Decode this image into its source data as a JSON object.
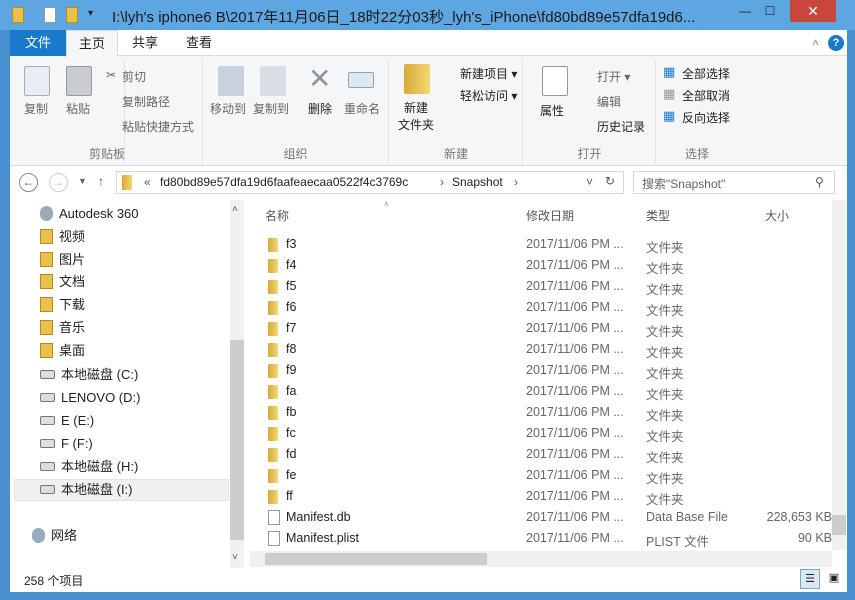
{
  "window": {
    "title": "I:\\lyh's iphone6 B\\2017年11月06日_18时22分03秒_lyh's_iPhone\\fd80bd89e57dfa19d6...",
    "close": "✕",
    "maximize": "☐",
    "minimize": "—"
  },
  "ribbon_tabs": [
    "文件",
    "主页",
    "共享",
    "查看"
  ],
  "ribbon": {
    "clipboard": {
      "label": "剪贴板",
      "copy": "复制",
      "paste": "粘贴",
      "cut": "剪切",
      "copy_path": "复制路径",
      "paste_shortcut": "粘贴快捷方式"
    },
    "organize": {
      "label": "组织",
      "move_to": "移动到",
      "copy_to": "复制到",
      "delete": "删除",
      "rename": "重命名"
    },
    "new": {
      "label": "新建",
      "new_folder": "新建\n文件夹",
      "new_item": "新建项目 ▾",
      "easy_access": "轻松访问 ▾"
    },
    "open": {
      "label": "打开",
      "properties": "属性",
      "open": "打开 ▾",
      "edit": "编辑",
      "history": "历史记录"
    },
    "select": {
      "label": "选择",
      "select_all": "全部选择",
      "select_none": "全部取消",
      "invert": "反向选择"
    }
  },
  "address": {
    "prefix": "«",
    "segment1": "fd80bd89e57dfa19d6faafeaecaa0522f4c3769c",
    "sep": "›",
    "segment2": "Snapshot",
    "search_placeholder": "搜索\"Snapshot\""
  },
  "nav": [
    "Autodesk 360",
    "视频",
    "图片",
    "文档",
    "下载",
    "音乐",
    "桌面",
    "本地磁盘 (C:)",
    "LENOVO (D:)",
    "E (E:)",
    "F (F:)",
    "本地磁盘 (H:)",
    "本地磁盘 (I:)",
    "网络"
  ],
  "columns": {
    "name": "名称",
    "date": "修改日期",
    "type": "类型",
    "size": "大小"
  },
  "files": [
    {
      "name": "f3",
      "date": "2017/11/06 PM ...",
      "type": "文件夹",
      "size": "",
      "kind": "folder"
    },
    {
      "name": "f4",
      "date": "2017/11/06 PM ...",
      "type": "文件夹",
      "size": "",
      "kind": "folder"
    },
    {
      "name": "f5",
      "date": "2017/11/06 PM ...",
      "type": "文件夹",
      "size": "",
      "kind": "folder"
    },
    {
      "name": "f6",
      "date": "2017/11/06 PM ...",
      "type": "文件夹",
      "size": "",
      "kind": "folder"
    },
    {
      "name": "f7",
      "date": "2017/11/06 PM ...",
      "type": "文件夹",
      "size": "",
      "kind": "folder"
    },
    {
      "name": "f8",
      "date": "2017/11/06 PM ...",
      "type": "文件夹",
      "size": "",
      "kind": "folder"
    },
    {
      "name": "f9",
      "date": "2017/11/06 PM ...",
      "type": "文件夹",
      "size": "",
      "kind": "folder"
    },
    {
      "name": "fa",
      "date": "2017/11/06 PM ...",
      "type": "文件夹",
      "size": "",
      "kind": "folder"
    },
    {
      "name": "fb",
      "date": "2017/11/06 PM ...",
      "type": "文件夹",
      "size": "",
      "kind": "folder"
    },
    {
      "name": "fc",
      "date": "2017/11/06 PM ...",
      "type": "文件夹",
      "size": "",
      "kind": "folder"
    },
    {
      "name": "fd",
      "date": "2017/11/06 PM ...",
      "type": "文件夹",
      "size": "",
      "kind": "folder"
    },
    {
      "name": "fe",
      "date": "2017/11/06 PM ...",
      "type": "文件夹",
      "size": "",
      "kind": "folder"
    },
    {
      "name": "ff",
      "date": "2017/11/06 PM ...",
      "type": "文件夹",
      "size": "",
      "kind": "folder"
    },
    {
      "name": "Manifest.db",
      "date": "2017/11/06 PM ...",
      "type": "Data Base File",
      "size": "228,653 KB",
      "kind": "file"
    },
    {
      "name": "Manifest.plist",
      "date": "2017/11/06 PM ...",
      "type": "PLIST 文件",
      "size": "90 KB",
      "kind": "file"
    }
  ],
  "status": {
    "count": "258 个项目"
  }
}
